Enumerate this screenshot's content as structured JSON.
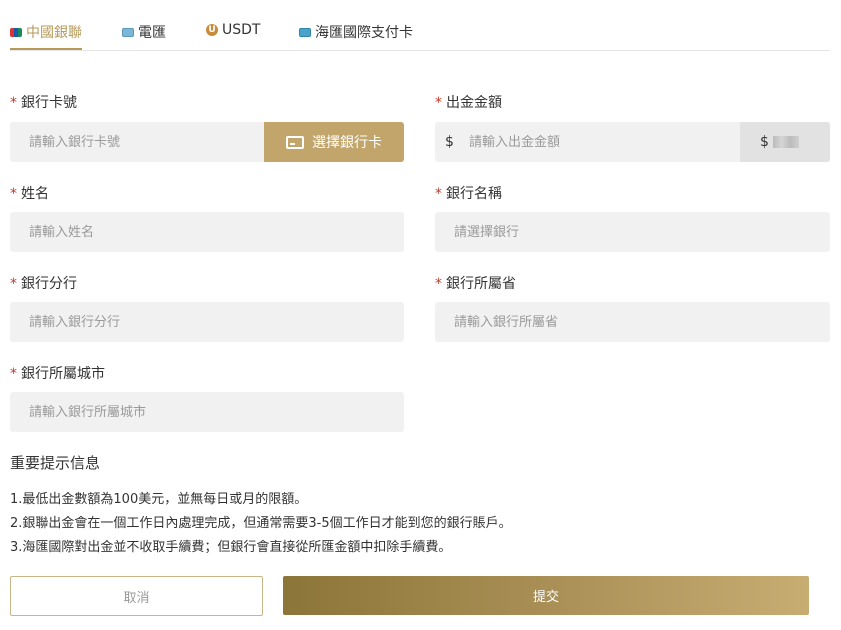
{
  "tabs": [
    {
      "label": "中國銀聯",
      "icon": "unionpay-icon",
      "active": true
    },
    {
      "label": "電匯",
      "icon": "wire-transfer-icon",
      "active": false
    },
    {
      "label": "USDT",
      "icon": "usdt-icon",
      "active": false
    },
    {
      "label": "海匯國際支付卡",
      "icon": "payment-card-icon",
      "active": false
    }
  ],
  "form": {
    "required_mark": "*",
    "card_number": {
      "label": "銀行卡號",
      "placeholder": "請輸入銀行卡號",
      "button_label": "選擇銀行卡"
    },
    "amount": {
      "label": "出金金額",
      "currency_symbol": "$",
      "placeholder": "請輸入出金金額",
      "rate_symbol": "$"
    },
    "name": {
      "label": "姓名",
      "placeholder": "請輸入姓名"
    },
    "bank_name": {
      "label": "銀行名稱",
      "placeholder": "請選擇銀行"
    },
    "branch": {
      "label": "銀行分行",
      "placeholder": "請輸入銀行分行"
    },
    "province": {
      "label": "銀行所屬省",
      "placeholder": "請輸入銀行所屬省"
    },
    "city": {
      "label": "銀行所屬城市",
      "placeholder": "請輸入銀行所屬城市"
    }
  },
  "notice": {
    "title": "重要提示信息",
    "items": [
      "1.最低出金數額為100美元，並無每日或月的限額。",
      "2.銀聯出金會在一個工作日內處理完成，但通常需要3-5個工作日才能到您的銀行賬戶。",
      "3.海匯國際對出金並不收取手續費；但銀行會直接從所匯金額中扣除手續費。"
    ]
  },
  "actions": {
    "cancel_label": "取消",
    "submit_label": "提交"
  },
  "colors": {
    "accent": "#b59a5a",
    "required": "#c0392b",
    "field_bg": "#f1f1f1"
  }
}
